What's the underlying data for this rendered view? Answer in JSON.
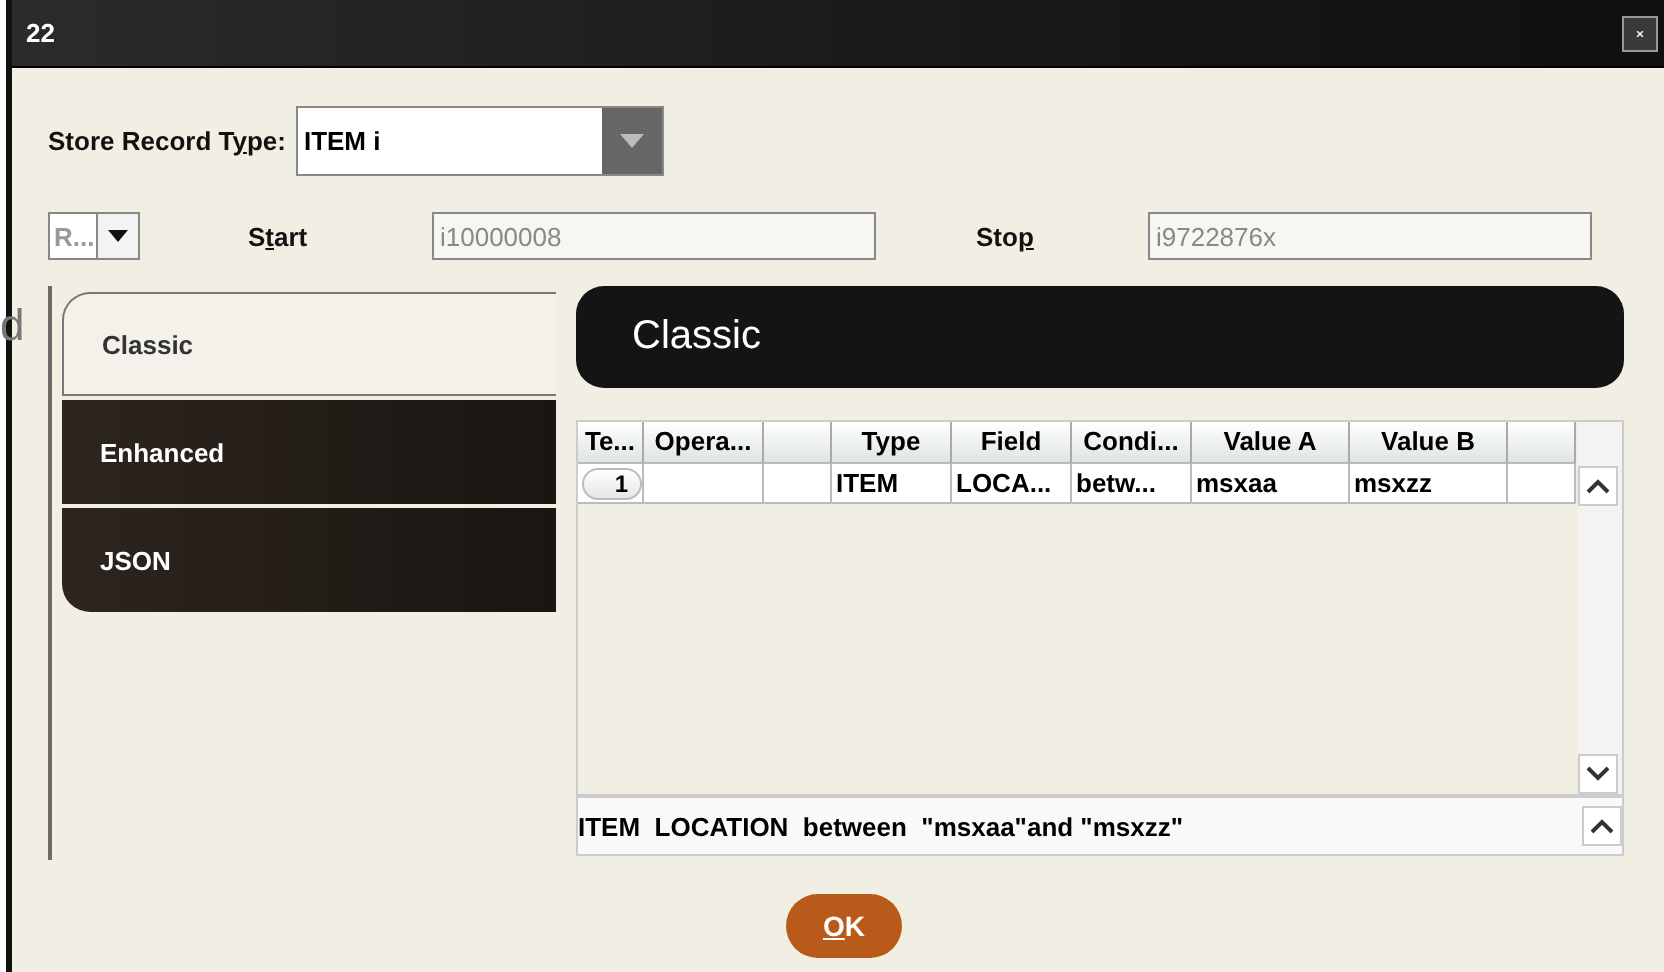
{
  "background_text": "d",
  "window": {
    "title": "22"
  },
  "record_type": {
    "label_parts": [
      {
        "text": "Store Record T",
        "underlined": false
      },
      {
        "text": "y",
        "underlined": true
      },
      {
        "text": "pe:",
        "underlined": false
      }
    ],
    "value": "ITEM i"
  },
  "range": {
    "mode": "R...",
    "start": {
      "label_parts": [
        {
          "text": "S",
          "underlined": false
        },
        {
          "text": "t",
          "underlined": true
        },
        {
          "text": "art",
          "underlined": false
        }
      ],
      "value": "i10000008",
      "disabled": true
    },
    "stop": {
      "label_parts": [
        {
          "text": "Sto",
          "underlined": false
        },
        {
          "text": "p",
          "underlined": true
        }
      ],
      "value": "i9722876x",
      "disabled": true
    }
  },
  "tabs": [
    {
      "label": "Classic",
      "selected": true
    },
    {
      "label": "Enhanced",
      "selected": false
    },
    {
      "label": "JSON",
      "selected": false
    }
  ],
  "panel_title": "Classic",
  "table": {
    "columns": [
      "Te...",
      "Opera...",
      "",
      "Type",
      "Field",
      "Condi...",
      "Value A",
      "Value B",
      ""
    ],
    "rows": [
      [
        "1",
        "",
        "",
        "ITEM",
        "LOCA...",
        "betw...",
        "msxaa",
        "msxzz",
        ""
      ]
    ]
  },
  "expression": "ITEM  LOCATION  between  \"msxaa\"and \"msxzz\"",
  "ok_button": {
    "label_parts": [
      {
        "text": "O",
        "underlined": true
      },
      {
        "text": "K",
        "underlined": false
      }
    ]
  }
}
